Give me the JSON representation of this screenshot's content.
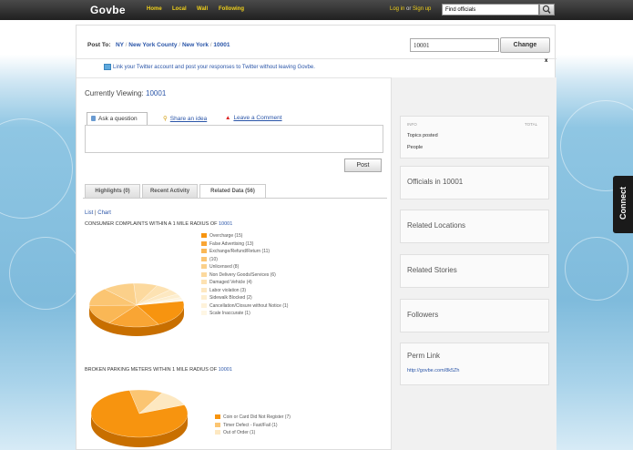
{
  "header": {
    "logo": "Govbe",
    "nav": [
      "Home",
      "Local",
      "Wall",
      "Following"
    ],
    "login": "Log in",
    "or": "or",
    "signup": "Sign up",
    "search_placeholder": "Find officials"
  },
  "post_to": {
    "label": "Post To:",
    "crumbs": [
      "NY",
      "New York County",
      "New York",
      "10001"
    ],
    "separator": "/",
    "zip_value": "10001",
    "change_label": "Change"
  },
  "twitter_notice": "Link your Twitter account and post your responses to Twitter without leaving Govbe.",
  "close_label": "x",
  "currently_viewing": {
    "label": "Currently Viewing:",
    "value": "10001"
  },
  "composer": {
    "ask_label": "Ask a question",
    "share_label": "Share an idea",
    "comment_label": "Leave a Comment",
    "post_label": "Post"
  },
  "tabs": [
    "Highlights (0)",
    "Recent Activity",
    "Related Data (56)"
  ],
  "view_toggle": {
    "list": "List",
    "sep": "|",
    "chart": "Chart"
  },
  "charts": [
    {
      "title_prefix": "Consumer Complaints within a 1 mile radius of",
      "title_link": "10001",
      "legend": [
        "Overcharge (15)",
        "False Advertising (13)",
        "Exchange/Refund/Return (11)",
        "(10)",
        "Unlicensed (8)",
        "Non Delivery Goods/Services (6)",
        "Damaged Vehicle (4)",
        "Labor violation (3)",
        "Sidewalk Blocked (2)",
        "Cancellation/Closure without Notice (1)",
        "Scale Inaccurate (1)"
      ]
    },
    {
      "title_prefix": "Broken Parking Meters within 1 mile radius of",
      "title_link": "10001",
      "legend": [
        "Coin or Card Did Not Register (7)",
        "Timer Defect - Fast/Fail (1)",
        "Out of Order (1)"
      ]
    }
  ],
  "chart_data": [
    {
      "type": "pie",
      "title": "Consumer Complaints within a 1 mile radius of 10001",
      "labels": [
        "Overcharge",
        "False Advertising",
        "Exchange/Refund/Return",
        "",
        "Unlicensed",
        "Non Delivery Goods/Services",
        "Damaged Vehicle",
        "Labor violation",
        "Sidewalk Blocked",
        "Cancellation/Closure without Notice",
        "Scale Inaccurate"
      ],
      "values": [
        15,
        13,
        11,
        10,
        8,
        6,
        4,
        3,
        2,
        1,
        1
      ],
      "colors": [
        "#f7940f",
        "#f9a534",
        "#fab755",
        "#fbc572",
        "#fbd08a",
        "#fcd99e",
        "#fde2b2",
        "#fde8c1",
        "#fdeecf",
        "#fef2da",
        "#fef6e4"
      ],
      "legend_position": "right"
    },
    {
      "type": "pie",
      "title": "Broken Parking Meters within 1 mile radius of 10001",
      "labels": [
        "Coin or Card Did Not Register",
        "Timer Defect - Fast/Fail",
        "Out of Order"
      ],
      "values": [
        7,
        1,
        1
      ],
      "colors": [
        "#f7940f",
        "#fbc572",
        "#fde8c1"
      ],
      "legend_position": "right"
    }
  ],
  "sidebar": {
    "info_header": "INFO",
    "total_header": "TOTAL",
    "topics_posted": "Topics posted",
    "people": "People",
    "officials": "Officials in 10001",
    "related_locations": "Related Locations",
    "related_stories": "Related Stories",
    "followers": "Followers",
    "perm_link_title": "Perm Link",
    "perm_link_url": "http://govbe.com/8k5Zh"
  },
  "connect_label": "Connect"
}
